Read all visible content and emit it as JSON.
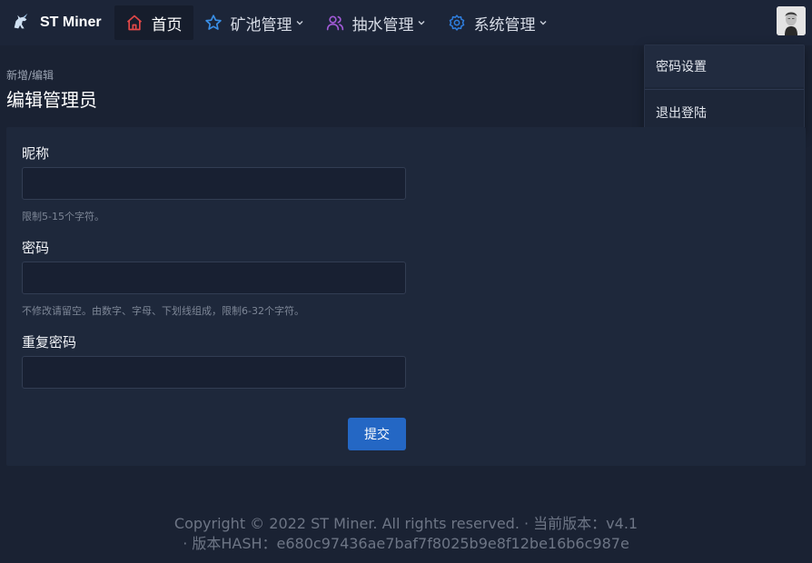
{
  "brand": {
    "name": "ST Miner",
    "logo_icon": "unicorn-logo-icon"
  },
  "nav": {
    "items": [
      {
        "label": "首页",
        "icon": "home-icon",
        "color": "#e04848",
        "active": true,
        "has_caret": false
      },
      {
        "label": "矿池管理",
        "icon": "star-icon",
        "color": "#3a8fe6",
        "active": false,
        "has_caret": true
      },
      {
        "label": "抽水管理",
        "icon": "users-icon",
        "color": "#a15ad6",
        "active": false,
        "has_caret": true
      },
      {
        "label": "系统管理",
        "icon": "gear-icon",
        "color": "#2f7fe0",
        "active": false,
        "has_caret": true
      }
    ]
  },
  "user_menu": {
    "items": [
      {
        "label": "密码设置"
      },
      {
        "label": "退出登陆"
      }
    ]
  },
  "breadcrumb": "新增/编辑",
  "page_title": "编辑管理员",
  "form": {
    "nickname": {
      "label": "昵称",
      "value": "",
      "help": "限制5-15个字符。"
    },
    "password": {
      "label": "密码",
      "value": "",
      "help": "不修改请留空。由数字、字母、下划线组成，限制6-32个字符。"
    },
    "repeat_password": {
      "label": "重复密码",
      "value": ""
    },
    "submit_label": "提交"
  },
  "footer": {
    "line1": "Copyright © 2022 ST Miner. All rights reserved.  ·  当前版本：v4.1",
    "line2": "·  版本HASH：e680c97436ae7baf7f8025b9e8f12be16b6c987e"
  },
  "colors": {
    "accent": "#2467c4",
    "background": "#1a2233",
    "card": "#1e283b"
  }
}
